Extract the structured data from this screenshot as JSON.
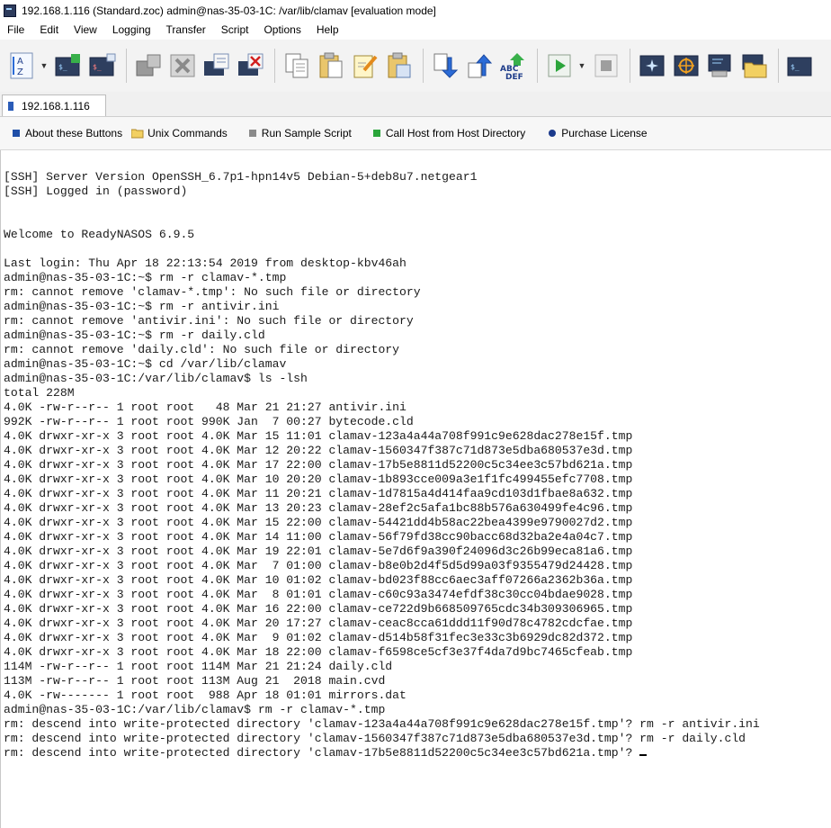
{
  "window": {
    "title": "192.168.1.116 (Standard.zoc) admin@nas-35-03-1C: /var/lib/clamav [evaluation mode]"
  },
  "menu": [
    "File",
    "Edit",
    "View",
    "Logging",
    "Transfer",
    "Script",
    "Options",
    "Help"
  ],
  "toolbar": {
    "icons": [
      "sort-az-icon",
      "session-icon",
      "session-tabs-icon",
      "disconnect-icon",
      "cancel-icon",
      "session-edit-icon",
      "session-close-icon",
      "copy-doc-icon",
      "paste-icon",
      "notepad-icon",
      "clipboard-icon",
      "download-icon",
      "upload-icon",
      "abc-def-icon",
      "play-script-icon",
      "stop-script-icon",
      "compass-icon",
      "target-icon",
      "host-directory-icon",
      "folder-icon",
      "terminal-icon"
    ]
  },
  "tab": {
    "label": "192.168.1.116"
  },
  "user_buttons": [
    {
      "label": "About these Buttons",
      "icon": "blue-square-icon",
      "color": "#1f4fa8"
    },
    {
      "label": "Unix Commands",
      "icon": "folder-icon",
      "color": "#e8c55a"
    },
    {
      "label": "Run Sample Script",
      "icon": "gray-square-icon",
      "color": "#8a8a8a"
    },
    {
      "label": "Call Host from Host Directory",
      "icon": "green-square-icon",
      "color": "#2aa53a"
    },
    {
      "label": "Purchase License",
      "icon": "blue-dot-icon",
      "color": "#1b3a8c"
    }
  ],
  "terminal": {
    "lines": [
      "[SSH] Server Version OpenSSH_6.7p1-hpn14v5 Debian-5+deb8u7.netgear1",
      "[SSH] Logged in (password)",
      "",
      "",
      "Welcome to ReadyNASOS 6.9.5",
      "",
      "Last login: Thu Apr 18 22:13:54 2019 from desktop-kbv46ah",
      "admin@nas-35-03-1C:~$ rm -r clamav-*.tmp",
      "rm: cannot remove 'clamav-*.tmp': No such file or directory",
      "admin@nas-35-03-1C:~$ rm -r antivir.ini",
      "rm: cannot remove 'antivir.ini': No such file or directory",
      "admin@nas-35-03-1C:~$ rm -r daily.cld",
      "rm: cannot remove 'daily.cld': No such file or directory",
      "admin@nas-35-03-1C:~$ cd /var/lib/clamav",
      "admin@nas-35-03-1C:/var/lib/clamav$ ls -lsh",
      "total 228M",
      "4.0K -rw-r--r-- 1 root root   48 Mar 21 21:27 antivir.ini",
      "992K -rw-r--r-- 1 root root 990K Jan  7 00:27 bytecode.cld",
      "4.0K drwxr-xr-x 3 root root 4.0K Mar 15 11:01 clamav-123a4a44a708f991c9e628dac278e15f.tmp",
      "4.0K drwxr-xr-x 3 root root 4.0K Mar 12 20:22 clamav-1560347f387c71d873e5dba680537e3d.tmp",
      "4.0K drwxr-xr-x 3 root root 4.0K Mar 17 22:00 clamav-17b5e8811d52200c5c34ee3c57bd621a.tmp",
      "4.0K drwxr-xr-x 3 root root 4.0K Mar 10 20:20 clamav-1b893cce009a3e1f1fc499455efc7708.tmp",
      "4.0K drwxr-xr-x 3 root root 4.0K Mar 11 20:21 clamav-1d7815a4d414faa9cd103d1fbae8a632.tmp",
      "4.0K drwxr-xr-x 3 root root 4.0K Mar 13 20:23 clamav-28ef2c5afa1bc88b576a630499fe4c96.tmp",
      "4.0K drwxr-xr-x 3 root root 4.0K Mar 15 22:00 clamav-54421dd4b58ac22bea4399e9790027d2.tmp",
      "4.0K drwxr-xr-x 3 root root 4.0K Mar 14 11:00 clamav-56f79fd38cc90bacc68d32ba2e4a04c7.tmp",
      "4.0K drwxr-xr-x 3 root root 4.0K Mar 19 22:01 clamav-5e7d6f9a390f24096d3c26b99eca81a6.tmp",
      "4.0K drwxr-xr-x 3 root root 4.0K Mar  7 01:00 clamav-b8e0b2d4f5d5d99a03f9355479d24428.tmp",
      "4.0K drwxr-xr-x 3 root root 4.0K Mar 10 01:02 clamav-bd023f88cc6aec3aff07266a2362b36a.tmp",
      "4.0K drwxr-xr-x 3 root root 4.0K Mar  8 01:01 clamav-c60c93a3474efdf38c30cc04bdae9028.tmp",
      "4.0K drwxr-xr-x 3 root root 4.0K Mar 16 22:00 clamav-ce722d9b668509765cdc34b309306965.tmp",
      "4.0K drwxr-xr-x 3 root root 4.0K Mar 20 17:27 clamav-ceac8cca61ddd11f90d78c4782cdcfae.tmp",
      "4.0K drwxr-xr-x 3 root root 4.0K Mar  9 01:02 clamav-d514b58f31fec3e33c3b6929dc82d372.tmp",
      "4.0K drwxr-xr-x 3 root root 4.0K Mar 18 22:00 clamav-f6598ce5cf3e37f4da7d9bc7465cfeab.tmp",
      "114M -rw-r--r-- 1 root root 114M Mar 21 21:24 daily.cld",
      "113M -rw-r--r-- 1 root root 113M Aug 21  2018 main.cvd",
      "4.0K -rw------- 1 root root  988 Apr 18 01:01 mirrors.dat",
      "admin@nas-35-03-1C:/var/lib/clamav$ rm -r clamav-*.tmp",
      "rm: descend into write-protected directory 'clamav-123a4a44a708f991c9e628dac278e15f.tmp'? rm -r antivir.ini",
      "rm: descend into write-protected directory 'clamav-1560347f387c71d873e5dba680537e3d.tmp'? rm -r daily.cld",
      "rm: descend into write-protected directory 'clamav-17b5e8811d52200c5c34ee3c57bd621a.tmp'? "
    ]
  }
}
